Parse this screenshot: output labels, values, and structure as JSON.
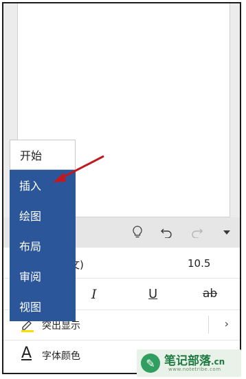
{
  "menu": {
    "items": [
      {
        "label": "开始",
        "active": true
      },
      {
        "label": "插入",
        "active": false
      },
      {
        "label": "绘图",
        "active": false
      },
      {
        "label": "布局",
        "active": false
      },
      {
        "label": "审阅",
        "active": false
      },
      {
        "label": "视图",
        "active": false
      }
    ]
  },
  "toolbar": {
    "icons": [
      "lightbulb-icon",
      "undo-icon",
      "redo-icon",
      "dropdown-arrow-icon"
    ]
  },
  "font": {
    "name_partial": "文)",
    "size": "10.5"
  },
  "format": {
    "italic": "I",
    "underline": "U",
    "strikethrough": "ab"
  },
  "rows": {
    "highlight_label": "突出显示",
    "font_color_label": "字体颜色",
    "font_color_letter": "A"
  },
  "watermark": {
    "title": "笔记部落",
    "domain_suffix": ".cn",
    "subtitle": "www.notetribe.com"
  },
  "colors": {
    "menu_blue": "#2b579a",
    "arrow_red": "#c0191f",
    "highlight_yellow": "#f5e000"
  }
}
